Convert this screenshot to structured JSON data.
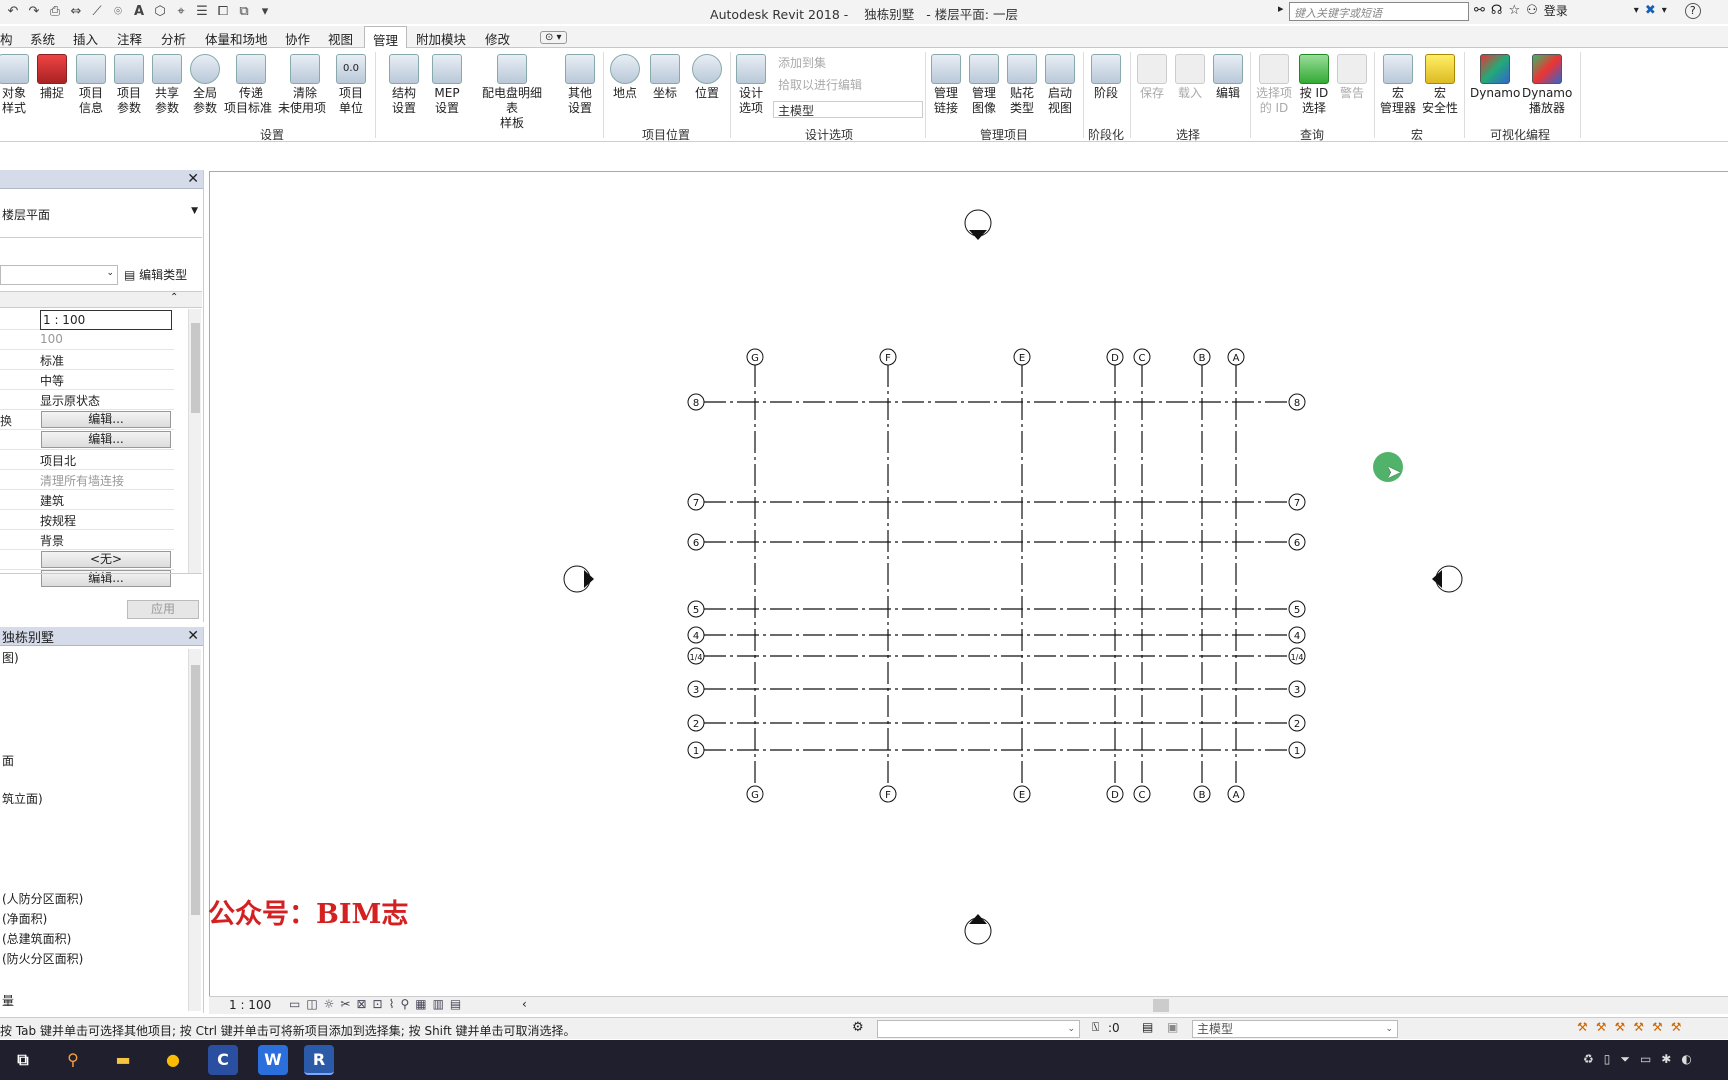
{
  "window": {
    "app_name": "Autodesk Revit 2018 -",
    "project": "独栋别墅",
    "view": "- 楼层平面: 一层"
  },
  "search": {
    "placeholder": "键入关键字或短语"
  },
  "account": {
    "login_label": "登录"
  },
  "tabs": [
    {
      "label": "构"
    },
    {
      "label": "系统"
    },
    {
      "label": "插入"
    },
    {
      "label": "注释"
    },
    {
      "label": "分析"
    },
    {
      "label": "体量和场地"
    },
    {
      "label": "协作"
    },
    {
      "label": "视图"
    },
    {
      "label": "管理"
    },
    {
      "label": "附加模块"
    },
    {
      "label": "修改"
    }
  ],
  "ribbon": {
    "buttons": [
      {
        "l1": "对象",
        "l2": "样式"
      },
      {
        "l1": "捕捉",
        "l2": ""
      },
      {
        "l1": "项目",
        "l2": "信息"
      },
      {
        "l1": "项目",
        "l2": "参数"
      },
      {
        "l1": "共享",
        "l2": "参数"
      },
      {
        "l1": "全局",
        "l2": "参数"
      },
      {
        "l1": "传递",
        "l2": "项目标准"
      },
      {
        "l1": "清除",
        "l2": "未使用项"
      },
      {
        "l1": "项目",
        "l2": "单位"
      },
      {
        "l1": "结构",
        "l2": "设置"
      },
      {
        "l1": "MEP",
        "l2": "设置"
      },
      {
        "l1": "配电盘明细表",
        "l2": "样板"
      },
      {
        "l1": "其他",
        "l2": "设置"
      },
      {
        "l1": "地点",
        "l2": ""
      },
      {
        "l1": "坐标",
        "l2": ""
      },
      {
        "l1": "位置",
        "l2": ""
      },
      {
        "l1": "设计",
        "l2": "选项"
      },
      {
        "l1": "管理",
        "l2": "链接"
      },
      {
        "l1": "管理",
        "l2": "图像"
      },
      {
        "l1": "贴花",
        "l2": "类型"
      },
      {
        "l1": "启动",
        "l2": "视图"
      },
      {
        "l1": "阶段",
        "l2": ""
      },
      {
        "l1": "保存",
        "l2": ""
      },
      {
        "l1": "载入",
        "l2": ""
      },
      {
        "l1": "编辑",
        "l2": ""
      },
      {
        "l1": "选择项",
        "l2": "的 ID"
      },
      {
        "l1": "按 ID",
        "l2": "选择"
      },
      {
        "l1": "警告",
        "l2": ""
      },
      {
        "l1": "宏",
        "l2": "管理器"
      },
      {
        "l1": "宏",
        "l2": "安全性"
      },
      {
        "l1": "Dynamo",
        "l2": ""
      },
      {
        "l1": "Dynamo",
        "l2": "播放器"
      }
    ],
    "design_small": {
      "add_to_set": "添加到集",
      "pick_edit": "拾取以进行编辑",
      "main_model": "主模型"
    },
    "panels": [
      {
        "label": "设置"
      },
      {
        "label": "项目位置"
      },
      {
        "label": "设计选项"
      },
      {
        "label": "管理项目"
      },
      {
        "label": "阶段化"
      },
      {
        "label": "选择"
      },
      {
        "label": "查询"
      },
      {
        "label": "宏"
      },
      {
        "label": "可视化编程"
      }
    ]
  },
  "properties": {
    "type_name": "楼层平面",
    "edit_type": "编辑类型",
    "rows": [
      {
        "label": "",
        "value": "1 : 100"
      },
      {
        "label": "",
        "value": "100"
      },
      {
        "label": "",
        "value": "标准"
      },
      {
        "label": "",
        "value": "中等"
      },
      {
        "label": "",
        "value": "显示原状态"
      },
      {
        "label": "换",
        "value": "编辑..."
      },
      {
        "label": "",
        "value": "编辑..."
      },
      {
        "label": "",
        "value": "项目北"
      },
      {
        "label": "",
        "value": "清理所有墙连接"
      },
      {
        "label": "",
        "value": "建筑"
      },
      {
        "label": "",
        "value": "按规程"
      },
      {
        "label": "",
        "value": "背景"
      },
      {
        "label": "",
        "value": "<无>"
      },
      {
        "label": "",
        "value": "编辑..."
      }
    ],
    "apply_label": "应用"
  },
  "browser": {
    "title": "独栋别墅",
    "items": [
      {
        "label": "图)"
      },
      {
        "label": "面"
      },
      {
        "label": "筑立面)"
      },
      {
        "label": "(人防分区面积)"
      },
      {
        "label": "(净面积)"
      },
      {
        "label": "(总建筑面积)"
      },
      {
        "label": "(防火分区面积)"
      },
      {
        "label": "量"
      }
    ]
  },
  "watermark": "公众号：BIM志",
  "grid": {
    "letters": [
      "G",
      "F",
      "E",
      "D",
      "C",
      "B",
      "A"
    ],
    "numbers": [
      "8",
      "7",
      "6",
      "5",
      "4",
      "1/4",
      "3",
      "2",
      "1"
    ]
  },
  "viewbar": {
    "scale": "1 : 100"
  },
  "status": {
    "message": "按 Tab 键并单击可选择其他项目; 按 Ctrl 键并单击可将新项目添加到选择集; 按 Shift 键并单击可取消选择。",
    "zero": ":0",
    "model": "主模型"
  },
  "taskbar": {
    "apps": [
      {
        "name": "task-view",
        "glyph": "⧉"
      },
      {
        "name": "search",
        "glyph": "⚲"
      },
      {
        "name": "file-explorer",
        "glyph": "▬"
      },
      {
        "name": "chrome",
        "glyph": "●"
      },
      {
        "name": "cad",
        "glyph": "C"
      },
      {
        "name": "wps",
        "glyph": "W"
      },
      {
        "name": "revit",
        "glyph": "R"
      }
    ]
  }
}
